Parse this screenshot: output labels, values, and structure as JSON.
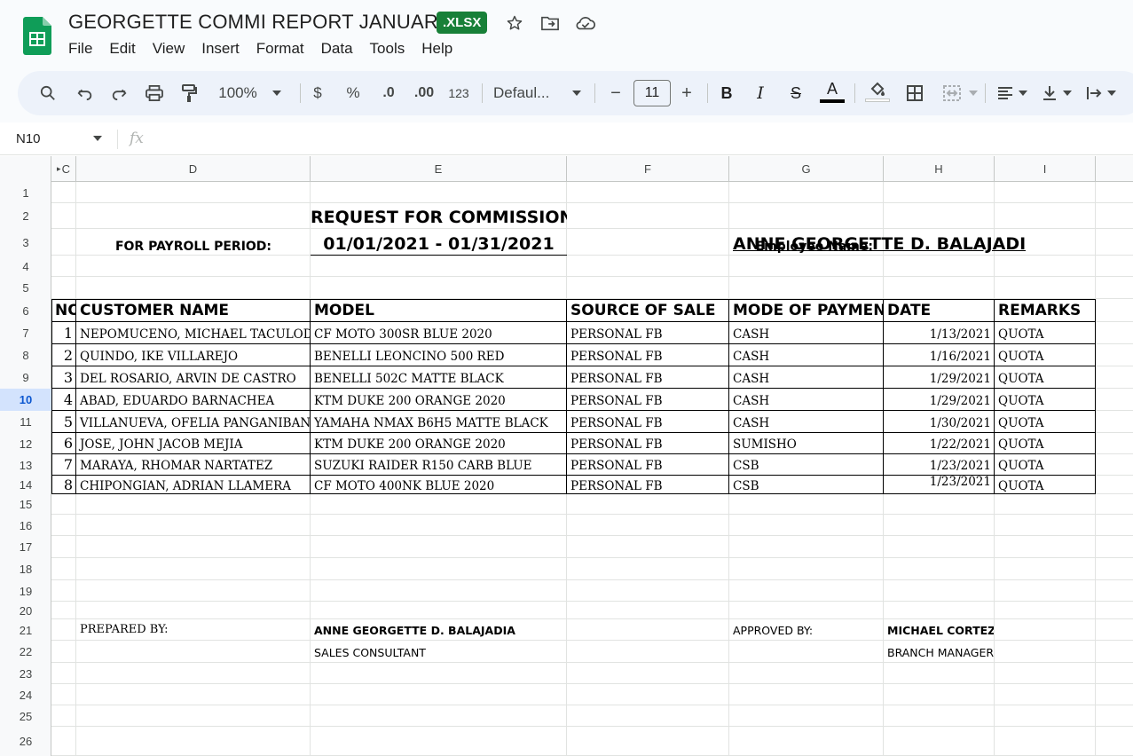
{
  "app": {
    "doc_title": "GEORGETTE COMMI REPORT JANUARY",
    "file_badge": ".XLSX",
    "accent_color": "#188038"
  },
  "menu": [
    "File",
    "Edit",
    "View",
    "Insert",
    "Format",
    "Data",
    "Tools",
    "Help"
  ],
  "toolbar": {
    "zoom": "100%",
    "currency": "$",
    "percent": "%",
    "dec_decrease": ".0",
    "dec_increase": ".00",
    "number_format": "123",
    "font": "Defaul...",
    "font_size": "11",
    "minus": "−",
    "plus": "+",
    "bold": "B",
    "italic": "I",
    "strike": "S",
    "text_color": "A"
  },
  "formula_bar": {
    "name_box": "N10",
    "fx": "fx"
  },
  "columns": [
    "C",
    "D",
    "E",
    "F",
    "G",
    "H",
    "I"
  ],
  "rows": [
    "1",
    "2",
    "3",
    "4",
    "5",
    "6",
    "7",
    "8",
    "9",
    "10",
    "11",
    "12",
    "13",
    "14",
    "15",
    "16",
    "17",
    "18",
    "19",
    "20",
    "21",
    "22",
    "23",
    "24",
    "25",
    "26"
  ],
  "active_row": "10",
  "sheet": {
    "title": "REQUEST FOR COMMISSION",
    "period_label": "FOR PAYROLL PERIOD:",
    "period_value": "01/01/2021 - 01/31/2021",
    "employee_label": "Employee Name:",
    "employee_value": "ANNE GEORGETTE D. BALAJADIA",
    "headers": [
      "NO",
      "CUSTOMER NAME",
      "MODEL",
      "SOURCE OF SALE",
      "MODE OF PAYMENT",
      "DATE",
      "REMARKS"
    ],
    "rows": [
      {
        "no": "1",
        "customer": "NEPOMUCENO, MICHAEL TACULOD",
        "model": "CF MOTO 300SR BLUE 2020",
        "source": "PERSONAL FB",
        "payment": "CASH",
        "date": "1/13/2021",
        "remarks": "QUOTA"
      },
      {
        "no": "2",
        "customer": "QUINDO, IKE VILLAREJO",
        "model": "BENELLI LEONCINO 500 RED",
        "source": "PERSONAL FB",
        "payment": "CASH",
        "date": "1/16/2021",
        "remarks": "QUOTA"
      },
      {
        "no": "3",
        "customer": "DEL ROSARIO, ARVIN DE CASTRO",
        "model": "BENELLI 502C MATTE BLACK",
        "source": "PERSONAL FB",
        "payment": "CASH",
        "date": "1/29/2021",
        "remarks": "QUOTA"
      },
      {
        "no": "4",
        "customer": "ABAD, EDUARDO BARNACHEA",
        "model": "KTM DUKE 200 ORANGE 2020",
        "source": "PERSONAL FB",
        "payment": "CASH",
        "date": "1/29/2021",
        "remarks": "QUOTA"
      },
      {
        "no": "5",
        "customer": "VILLANUEVA, OFELIA PANGANIBAN / VII",
        "model": "YAMAHA NMAX B6H5 MATTE BLACK",
        "source": "PERSONAL FB",
        "payment": "CASH",
        "date": "1/30/2021",
        "remarks": "QUOTA"
      },
      {
        "no": "6",
        "customer": "JOSE, JOHN JACOB MEJIA",
        "model": "KTM DUKE 200 ORANGE 2020",
        "source": "PERSONAL FB",
        "payment": "SUMISHO",
        "date": "1/22/2021",
        "remarks": "QUOTA"
      },
      {
        "no": "7",
        "customer": "MARAYA, RHOMAR NARTATEZ",
        "model": "SUZUKI RAIDER R150 CARB BLUE",
        "source": "PERSONAL FB",
        "payment": "CSB",
        "date": "1/23/2021",
        "remarks": "QUOTA"
      },
      {
        "no": "8",
        "customer": "CHIPONGIAN, ADRIAN LLAMERA",
        "model": "CF MOTO 400NK BLUE 2020",
        "source": "PERSONAL FB",
        "payment": "CSB",
        "date": "1/23/2021",
        "remarks": "QUOTA"
      }
    ],
    "prepared_label": "PREPARED BY:",
    "prepared_name": "ANNE GEORGETTE D. BALAJADIA",
    "prepared_title": "SALES CONSULTANT",
    "approved_label": "APPROVED BY:",
    "approved_name": "MICHAEL CORTEZ",
    "approved_title": "BRANCH MANAGER"
  }
}
